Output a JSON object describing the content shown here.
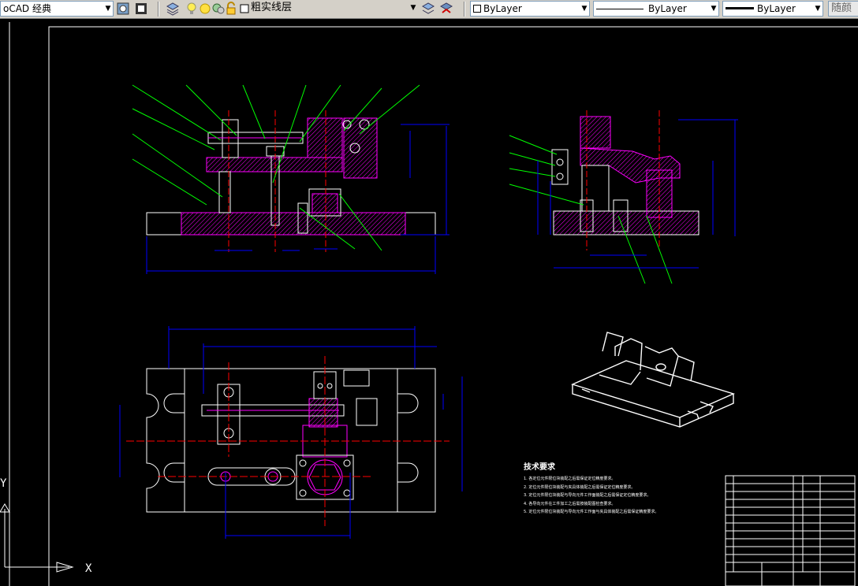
{
  "toolbar": {
    "workspace": "oCAD 经典",
    "layer_name": "粗实线层",
    "color": "ByLayer",
    "linetype": "ByLayer",
    "lineweight": "ByLayer",
    "plotstyle": "随颜"
  },
  "drawing": {
    "tech_title": "技术要求",
    "tech_notes": [
      "1. 各定位元件限位块装配之后需保证定位精度要求。",
      "2. 定位元件限位块装配与夹具体装配之后需保证定位精度要求。",
      "3. 定位元件限位块装配与导向元件工作面装配之后需保证定位精度要求。",
      "4. 各导向元件在工件加工之后需按装配图检查要求。",
      "5. 定位元件限位块装配与导向元件工作面与夹具体装配之后需保证精度要求。"
    ]
  },
  "ucs": {
    "x_label": "X",
    "y_label": "Y"
  },
  "colors": {
    "canvas_bg": "#000000",
    "outline": "#ffffff",
    "section": "#ff00ff",
    "dimension": "#0000ff",
    "leader": "#00ff00",
    "center": "#ff0000"
  }
}
